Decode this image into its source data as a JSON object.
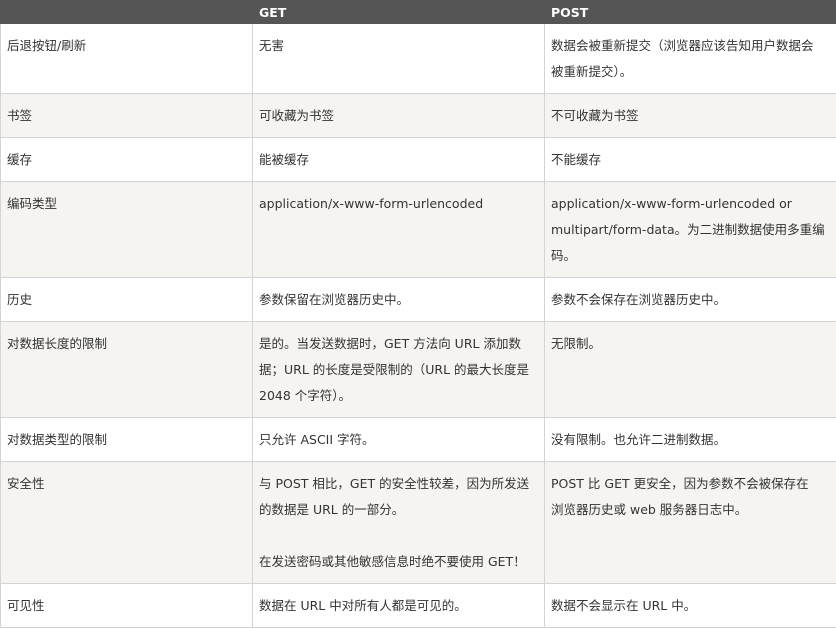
{
  "table": {
    "headers": [
      "",
      "GET",
      "POST"
    ],
    "rows": [
      {
        "label": "后退按钮/刷新",
        "get": [
          "无害"
        ],
        "post": [
          "数据会被重新提交（浏览器应该告知用户数据会",
          "被重新提交）。"
        ]
      },
      {
        "label": "书签",
        "get": [
          "可收藏为书签"
        ],
        "post": [
          "不可收藏为书签"
        ]
      },
      {
        "label": "缓存",
        "get": [
          "能被缓存"
        ],
        "post": [
          "不能缓存"
        ]
      },
      {
        "label": "编码类型",
        "get": [
          "application/x-www-form-urlencoded"
        ],
        "post": [
          "application/x-www-form-urlencoded or",
          "multipart/form-data。为二进制数据使用多重编",
          "码。"
        ]
      },
      {
        "label": "历史",
        "get": [
          "参数保留在浏览器历史中。"
        ],
        "post": [
          "参数不会保存在浏览器历史中。"
        ]
      },
      {
        "label": "对数据长度的限制",
        "get": [
          "是的。当发送数据时，GET 方法向 URL 添加数",
          "据；URL 的长度是受限制的（URL 的最大长度是",
          "2048 个字符）。"
        ],
        "post": [
          "无限制。"
        ]
      },
      {
        "label": "对数据类型的限制",
        "get": [
          "只允许 ASCII 字符。"
        ],
        "post": [
          "没有限制。也允许二进制数据。"
        ]
      },
      {
        "label": "安全性",
        "get": [
          "与 POST 相比，GET 的安全性较差，因为所发送",
          "的数据是 URL 的一部分。",
          "",
          "在发送密码或其他敏感信息时绝不要使用 GET！"
        ],
        "post": [
          "POST 比 GET 更安全，因为参数不会被保存在",
          "浏览器历史或 web 服务器日志中。"
        ]
      },
      {
        "label": "可见性",
        "get": [
          "数据在 URL 中对所有人都是可见的。"
        ],
        "post": [
          "数据不会显示在 URL 中。"
        ]
      }
    ]
  },
  "colors": {
    "header_bg": "#555555",
    "header_text": "#ffffff",
    "alt_row_bg": "#f6f4f0",
    "border": "#d4d4d4",
    "text": "#333333"
  }
}
